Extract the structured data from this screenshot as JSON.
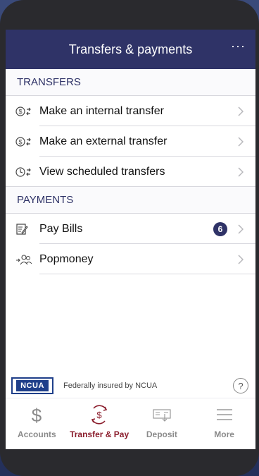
{
  "header": {
    "title": "Transfers & payments",
    "more_label": "···"
  },
  "transfers_section": {
    "heading": "TRANSFERS",
    "items": [
      {
        "label": "Make an internal transfer",
        "icon": "dollar-transfer-icon"
      },
      {
        "label": "Make an external transfer",
        "icon": "dollar-transfer-icon"
      },
      {
        "label": "View scheduled transfers",
        "icon": "clock-transfer-icon"
      }
    ]
  },
  "payments_section": {
    "heading": "PAYMENTS",
    "items": [
      {
        "label": "Pay Bills",
        "icon": "bill-icon",
        "badge": "6"
      },
      {
        "label": "Popmoney",
        "icon": "people-transfer-icon"
      }
    ]
  },
  "ncua": {
    "logo_text": "NCUA",
    "text": "Federally insured by NCUA",
    "help": "?"
  },
  "tabs": [
    {
      "label": "Accounts",
      "icon": "dollar-icon",
      "active": false
    },
    {
      "label": "Transfer & Pay",
      "icon": "transfer-pay-icon",
      "active": true
    },
    {
      "label": "Deposit",
      "icon": "check-deposit-icon",
      "active": false
    },
    {
      "label": "More",
      "icon": "menu-icon",
      "active": false
    }
  ],
  "colors": {
    "header_bg": "#2f3367",
    "active_tab": "#8b1d2c",
    "badge_bg": "#2f3367"
  }
}
